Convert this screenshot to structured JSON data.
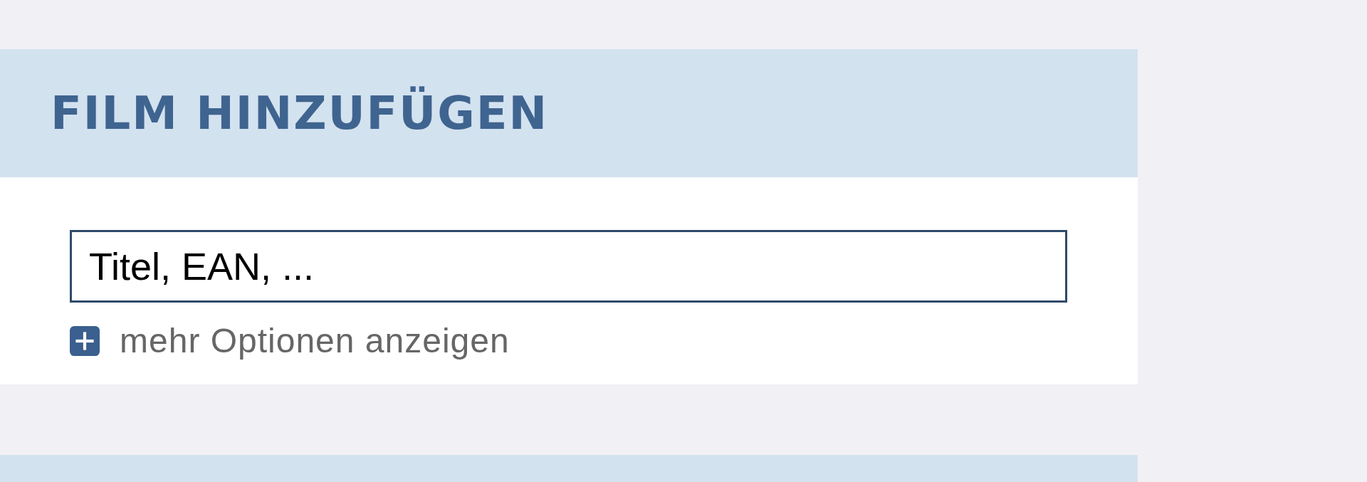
{
  "panel": {
    "title": "FILM HINZUFÜGEN"
  },
  "search": {
    "placeholder": "Titel, EAN, ..."
  },
  "options_toggle": {
    "label": "mehr Optionen anzeigen",
    "expanded": false
  }
}
